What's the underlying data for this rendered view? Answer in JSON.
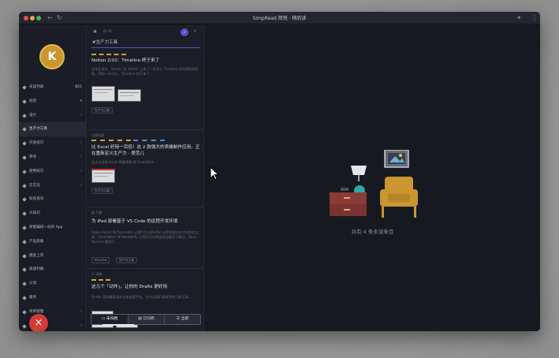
{
  "window": {
    "title": "SimpRead 简悦 · 稍后读"
  },
  "user": {
    "avatar_initial": "K"
  },
  "sidebar": {
    "items": [
      {
        "label": "未读列表",
        "count": "821",
        "arrow": ""
      },
      {
        "label": "标签",
        "count": "",
        "arrow": "▾"
      },
      {
        "label": "设计",
        "count": "",
        "arrow": "›"
      },
      {
        "label": "生产力工具",
        "count": "",
        "arrow": ""
      },
      {
        "label": "开发技巧",
        "count": "",
        "arrow": "›"
      },
      {
        "label": "参考",
        "count": "",
        "arrow": "›"
      },
      {
        "label": "使用技巧",
        "count": "",
        "arrow": "›"
      },
      {
        "label": "实实在",
        "count": "",
        "arrow": "›"
      },
      {
        "label": "科技资讯",
        "count": "",
        "arrow": ""
      },
      {
        "label": "大知识",
        "count": "",
        "arrow": ""
      },
      {
        "label": "新能编排一站的 App",
        "count": "",
        "arrow": ""
      },
      {
        "label": "产品思路",
        "count": "",
        "arrow": ""
      },
      {
        "label": "摸鱼上岸",
        "count": "",
        "arrow": ""
      },
      {
        "label": "极速利器",
        "count": "",
        "arrow": ""
      },
      {
        "label": "父母",
        "count": "",
        "arrow": ""
      },
      {
        "label": "服务",
        "count": "",
        "arrow": ""
      },
      {
        "label": "项目管理",
        "count": "",
        "arrow": "›"
      },
      {
        "label": "技术",
        "count": "",
        "arrow": "›"
      },
      {
        "label": "阅读",
        "count": "",
        "arrow": ""
      }
    ],
    "fab_icon": "×"
  },
  "list": {
    "header": {
      "page": "0 / 0",
      "search_icon": "search-icon",
      "check_icon": "check-icon"
    },
    "filter_value": "#生产力工具",
    "cards": [
      {
        "meta": "",
        "title": "Notion 2/10：Timeline 终于来了",
        "desc": "去年此来冬，Notion 在 Twitter 上发了一条关于 Timeline 的消息的预告图，到前一年之久，Timeline 终于来了…",
        "tags": [
          "生产力工具"
        ]
      },
      {
        "meta": "长图标题",
        "title": "比 Excel 好用一百倍！这 2 款强大的表格制作应用，正在重新定义生产力 - 爱范儿",
        "desc": "这天在没有 Excel 数据表格 和 SnapBash …",
        "tags": [
          "生产力工具"
        ]
      },
      {
        "meta": "备 只跟",
        "title": "为 iPad 部署基于 VS Code 的远程开发环境",
        "desc": "Apple Pencil 和 Procreate 让我们可以把 iPad 当作绘画与艺术创作的工具，OmniNotes 和 Notability 让我们可以把这类设备用于笔记，Bear、Ulysses 被用于…",
        "tags": [
          "iPad Pro",
          "生产力工具"
        ]
      },
      {
        "meta": "少 选路",
        "title": "这几个「动作」，让你的 Drafts 更好用",
        "desc": "Drafts 是我最喜欢的文本处理平台，在今天我们再推荐的几款工具…",
        "tags": []
      }
    ]
  },
  "bottom_tabs": [
    {
      "icon": "inbox-icon",
      "label": "未归档"
    },
    {
      "icon": "archive-icon",
      "label": "已归档"
    },
    {
      "icon": "list-icon",
      "label": "全部"
    }
  ],
  "main": {
    "empty_text": "共有 4 条未读条目"
  },
  "colors": {
    "accent": "#5b4fc4",
    "avatar": "#c9962f",
    "fab": "#d33b34",
    "dash_gold": "#c8a634",
    "dash_blue": "#4a8fd3"
  }
}
